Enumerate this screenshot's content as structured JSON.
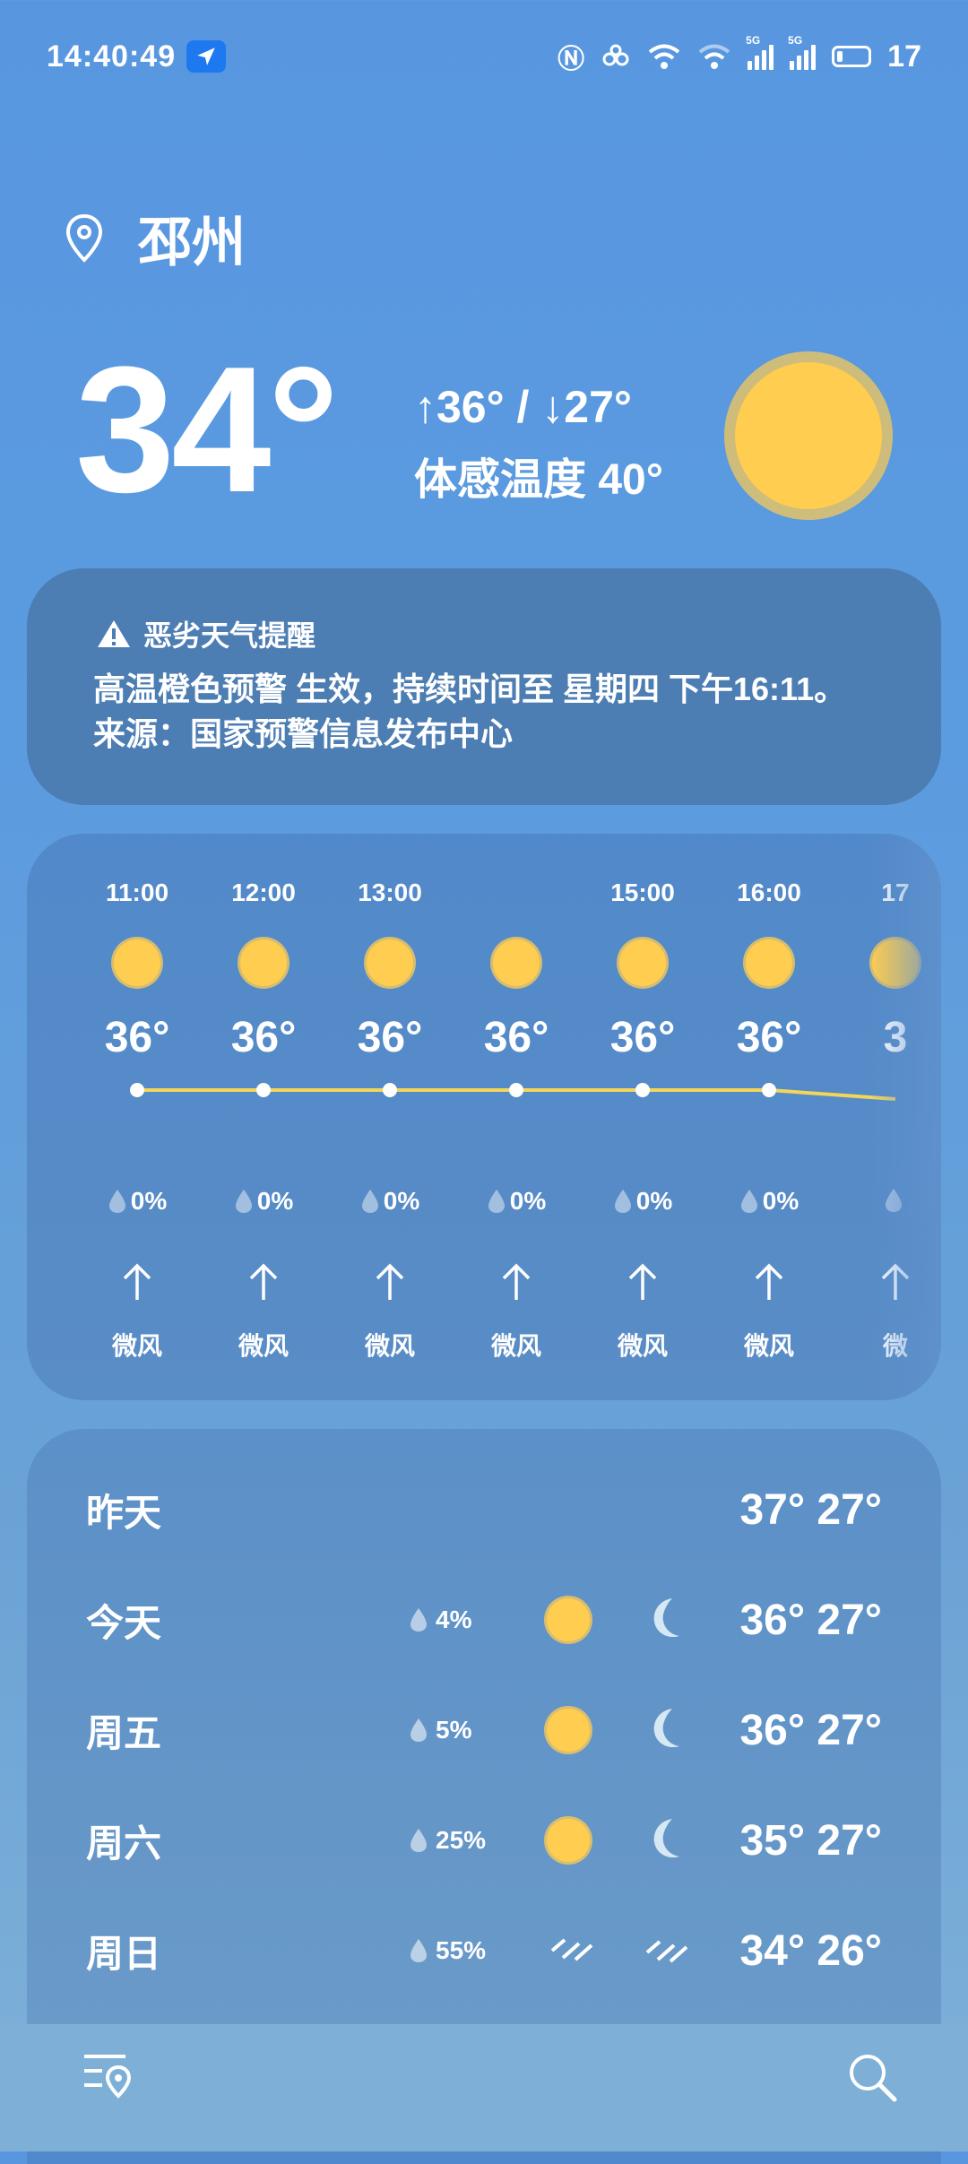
{
  "status": {
    "time": "14:40:49",
    "battery": "17"
  },
  "header": {
    "city": "邳州",
    "temperature": "34°",
    "high_low": "↑36° / ↓27°",
    "feels_like": "体感温度 40°"
  },
  "alert": {
    "title": "恶劣天气提醒",
    "line1": "高温橙色预警 生效，持续时间至 星期四 下午16:11。",
    "line2": "来源：国家预警信息发布中心"
  },
  "hourly": [
    {
      "time": "11:00",
      "temp": "36°",
      "rain": "0%",
      "wind": "微风"
    },
    {
      "time": "12:00",
      "temp": "36°",
      "rain": "0%",
      "wind": "微风"
    },
    {
      "time": "13:00",
      "temp": "36°",
      "rain": "0%",
      "wind": "微风"
    },
    {
      "time": "",
      "temp": "36°",
      "rain": "0%",
      "wind": "微风"
    },
    {
      "time": "15:00",
      "temp": "36°",
      "rain": "0%",
      "wind": "微风"
    },
    {
      "time": "16:00",
      "temp": "36°",
      "rain": "0%",
      "wind": "微风"
    },
    {
      "time": "17",
      "temp": "3",
      "rain": "",
      "wind": "微"
    }
  ],
  "daily": [
    {
      "day": "昨天",
      "rain": "",
      "day_icon": "",
      "night_icon": "",
      "temps": "37° 27°"
    },
    {
      "day": "今天",
      "rain": "4%",
      "day_icon": "sun-icon",
      "night_icon": "moon-icon",
      "temps": "36° 27°"
    },
    {
      "day": "周五",
      "rain": "5%",
      "day_icon": "sun-icon",
      "night_icon": "moon-icon",
      "temps": "36° 27°"
    },
    {
      "day": "周六",
      "rain": "25%",
      "day_icon": "sun-icon",
      "night_icon": "moon-icon",
      "temps": "35° 27°"
    },
    {
      "day": "周日",
      "rain": "55%",
      "day_icon": "rain-icon",
      "night_icon": "rain-icon",
      "temps": "34° 26°"
    }
  ],
  "colors": {
    "accent_blue": "#1e78f0",
    "sun": "#ffcd4f",
    "temp_line": "#f2d65a"
  }
}
